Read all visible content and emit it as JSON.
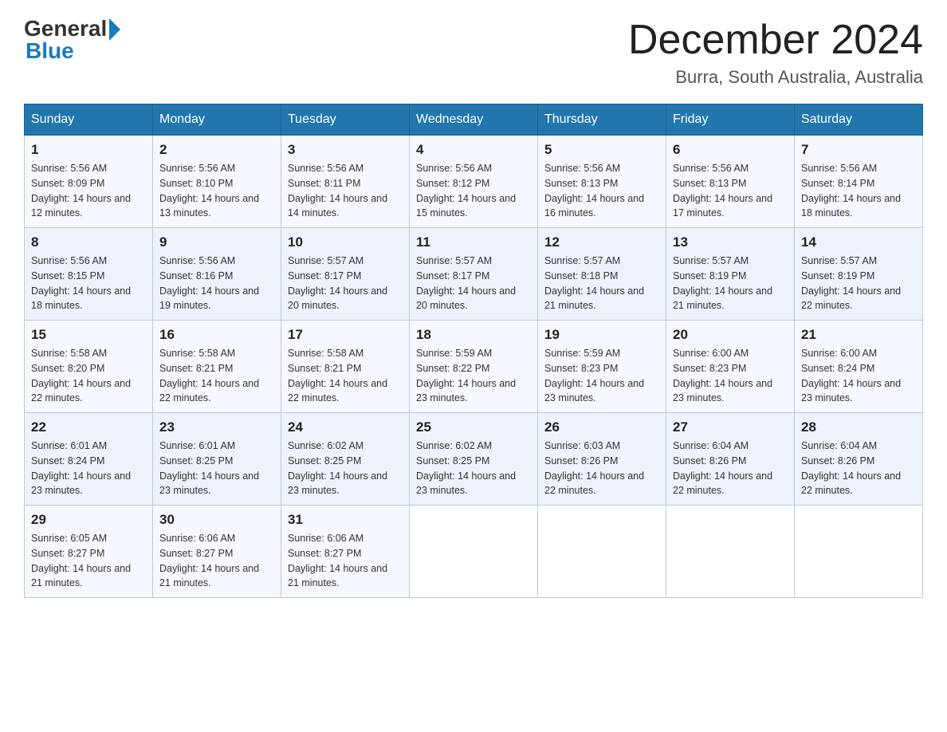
{
  "header": {
    "logo_general": "General",
    "logo_blue": "Blue",
    "title": "December 2024",
    "subtitle": "Burra, South Australia, Australia"
  },
  "days_of_week": [
    "Sunday",
    "Monday",
    "Tuesday",
    "Wednesday",
    "Thursday",
    "Friday",
    "Saturday"
  ],
  "weeks": [
    [
      {
        "day": "1",
        "sunrise": "5:56 AM",
        "sunset": "8:09 PM",
        "daylight": "14 hours and 12 minutes."
      },
      {
        "day": "2",
        "sunrise": "5:56 AM",
        "sunset": "8:10 PM",
        "daylight": "14 hours and 13 minutes."
      },
      {
        "day": "3",
        "sunrise": "5:56 AM",
        "sunset": "8:11 PM",
        "daylight": "14 hours and 14 minutes."
      },
      {
        "day": "4",
        "sunrise": "5:56 AM",
        "sunset": "8:12 PM",
        "daylight": "14 hours and 15 minutes."
      },
      {
        "day": "5",
        "sunrise": "5:56 AM",
        "sunset": "8:13 PM",
        "daylight": "14 hours and 16 minutes."
      },
      {
        "day": "6",
        "sunrise": "5:56 AM",
        "sunset": "8:13 PM",
        "daylight": "14 hours and 17 minutes."
      },
      {
        "day": "7",
        "sunrise": "5:56 AM",
        "sunset": "8:14 PM",
        "daylight": "14 hours and 18 minutes."
      }
    ],
    [
      {
        "day": "8",
        "sunrise": "5:56 AM",
        "sunset": "8:15 PM",
        "daylight": "14 hours and 18 minutes."
      },
      {
        "day": "9",
        "sunrise": "5:56 AM",
        "sunset": "8:16 PM",
        "daylight": "14 hours and 19 minutes."
      },
      {
        "day": "10",
        "sunrise": "5:57 AM",
        "sunset": "8:17 PM",
        "daylight": "14 hours and 20 minutes."
      },
      {
        "day": "11",
        "sunrise": "5:57 AM",
        "sunset": "8:17 PM",
        "daylight": "14 hours and 20 minutes."
      },
      {
        "day": "12",
        "sunrise": "5:57 AM",
        "sunset": "8:18 PM",
        "daylight": "14 hours and 21 minutes."
      },
      {
        "day": "13",
        "sunrise": "5:57 AM",
        "sunset": "8:19 PM",
        "daylight": "14 hours and 21 minutes."
      },
      {
        "day": "14",
        "sunrise": "5:57 AM",
        "sunset": "8:19 PM",
        "daylight": "14 hours and 22 minutes."
      }
    ],
    [
      {
        "day": "15",
        "sunrise": "5:58 AM",
        "sunset": "8:20 PM",
        "daylight": "14 hours and 22 minutes."
      },
      {
        "day": "16",
        "sunrise": "5:58 AM",
        "sunset": "8:21 PM",
        "daylight": "14 hours and 22 minutes."
      },
      {
        "day": "17",
        "sunrise": "5:58 AM",
        "sunset": "8:21 PM",
        "daylight": "14 hours and 22 minutes."
      },
      {
        "day": "18",
        "sunrise": "5:59 AM",
        "sunset": "8:22 PM",
        "daylight": "14 hours and 23 minutes."
      },
      {
        "day": "19",
        "sunrise": "5:59 AM",
        "sunset": "8:23 PM",
        "daylight": "14 hours and 23 minutes."
      },
      {
        "day": "20",
        "sunrise": "6:00 AM",
        "sunset": "8:23 PM",
        "daylight": "14 hours and 23 minutes."
      },
      {
        "day": "21",
        "sunrise": "6:00 AM",
        "sunset": "8:24 PM",
        "daylight": "14 hours and 23 minutes."
      }
    ],
    [
      {
        "day": "22",
        "sunrise": "6:01 AM",
        "sunset": "8:24 PM",
        "daylight": "14 hours and 23 minutes."
      },
      {
        "day": "23",
        "sunrise": "6:01 AM",
        "sunset": "8:25 PM",
        "daylight": "14 hours and 23 minutes."
      },
      {
        "day": "24",
        "sunrise": "6:02 AM",
        "sunset": "8:25 PM",
        "daylight": "14 hours and 23 minutes."
      },
      {
        "day": "25",
        "sunrise": "6:02 AM",
        "sunset": "8:25 PM",
        "daylight": "14 hours and 23 minutes."
      },
      {
        "day": "26",
        "sunrise": "6:03 AM",
        "sunset": "8:26 PM",
        "daylight": "14 hours and 22 minutes."
      },
      {
        "day": "27",
        "sunrise": "6:04 AM",
        "sunset": "8:26 PM",
        "daylight": "14 hours and 22 minutes."
      },
      {
        "day": "28",
        "sunrise": "6:04 AM",
        "sunset": "8:26 PM",
        "daylight": "14 hours and 22 minutes."
      }
    ],
    [
      {
        "day": "29",
        "sunrise": "6:05 AM",
        "sunset": "8:27 PM",
        "daylight": "14 hours and 21 minutes."
      },
      {
        "day": "30",
        "sunrise": "6:06 AM",
        "sunset": "8:27 PM",
        "daylight": "14 hours and 21 minutes."
      },
      {
        "day": "31",
        "sunrise": "6:06 AM",
        "sunset": "8:27 PM",
        "daylight": "14 hours and 21 minutes."
      },
      null,
      null,
      null,
      null
    ]
  ],
  "labels": {
    "sunrise_prefix": "Sunrise: ",
    "sunset_prefix": "Sunset: ",
    "daylight_prefix": "Daylight: "
  }
}
